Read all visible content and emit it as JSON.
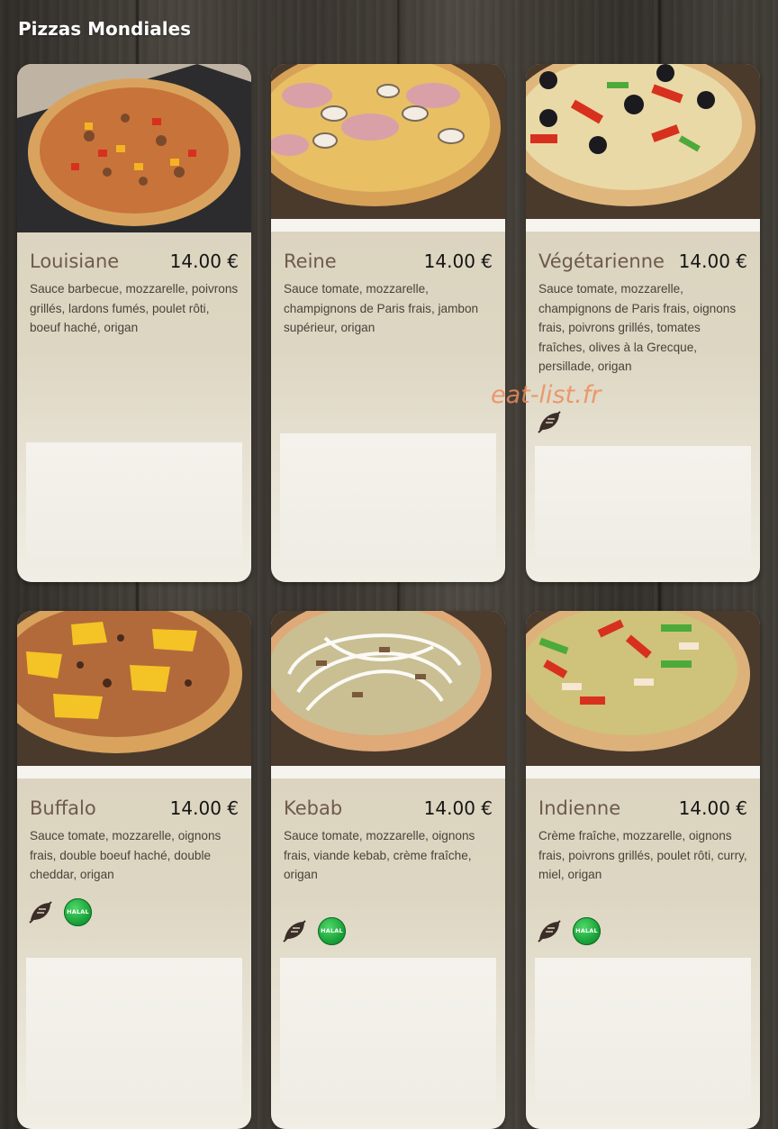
{
  "page": {
    "title": "Pizzas Mondiales",
    "watermark": "eat-list.fr"
  },
  "colors": {
    "name": "#6e5a4c",
    "price": "#141414",
    "card_top": "#d9d2bc",
    "halal_badge": "#1aa23a",
    "watermark": "#ec8c5a"
  },
  "pizzas": [
    {
      "name": "Louisiane",
      "price": "14.00 €",
      "description": "Sauce barbecue, mozzarelle, poivrons grillés, lardons fumés, poulet rôti, boeuf haché, origan",
      "badges": []
    },
    {
      "name": "Reine",
      "price": "14.00 €",
      "description": "Sauce tomate, mozzarelle, champignons de Paris frais, jambon supérieur, origan",
      "badges": []
    },
    {
      "name": "Végétarienne",
      "price": "14.00 €",
      "description": "Sauce tomate, mozzarelle, champignons de Paris frais, oignons frais, poivrons grillés, tomates fraîches, olives à la Grecque, persillade, origan",
      "badges": [
        "vegetarian-leaf-icon"
      ]
    },
    {
      "name": "Buffalo",
      "price": "14.00 €",
      "description": "Sauce tomate, mozzarelle, oignons frais, double boeuf haché, double cheddar, origan",
      "badges": [
        "vegetarian-leaf-icon",
        "halal-badge"
      ]
    },
    {
      "name": "Kebab",
      "price": "14.00 €",
      "description": "Sauce tomate, mozzarelle, oignons frais, viande kebab, crème fraîche, origan",
      "badges": [
        "vegetarian-leaf-icon",
        "halal-badge"
      ]
    },
    {
      "name": "Indienne",
      "price": "14.00 €",
      "description": "Crème fraîche, mozzarelle, oignons frais, poivrons grillés, poulet rôti, curry, miel, origan",
      "badges": [
        "vegetarian-leaf-icon",
        "halal-badge"
      ]
    }
  ],
  "halal_label": "HALAL"
}
